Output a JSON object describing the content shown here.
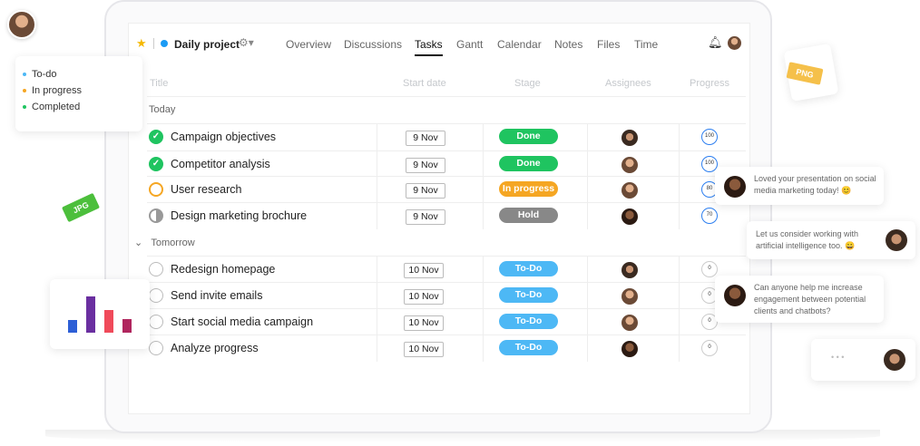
{
  "header": {
    "project": "Daily project",
    "tabs": [
      "Overview",
      "Discussions",
      "Tasks",
      "Gantt",
      "Calendar",
      "Notes",
      "Files",
      "Time"
    ],
    "active_tab": "Tasks"
  },
  "columns": [
    "Title",
    "Start date",
    "Stage",
    "Assignees",
    "Progress"
  ],
  "groups": [
    {
      "label": "Today",
      "tasks": [
        {
          "title": "Campaign objectives",
          "date": "9 Nov",
          "stage": "Done",
          "progress": "100",
          "status": "done"
        },
        {
          "title": "Competitor analysis",
          "date": "9 Nov",
          "stage": "Done",
          "progress": "100",
          "status": "done"
        },
        {
          "title": "User research",
          "date": "9 Nov",
          "stage": "In progress",
          "progress": "80",
          "status": "prog"
        },
        {
          "title": "Design marketing brochure",
          "date": "9 Nov",
          "stage": "Hold",
          "progress": "70",
          "status": "hold"
        }
      ]
    },
    {
      "label": "Tomorrow",
      "tasks": [
        {
          "title": "Redesign homepage",
          "date": "10 Nov",
          "stage": "To-Do",
          "progress": "0",
          "status": "todo"
        },
        {
          "title": "Send invite emails",
          "date": "10 Nov",
          "stage": "To-Do",
          "progress": "0",
          "status": "todo"
        },
        {
          "title": "Start social media campaign",
          "date": "10 Nov",
          "stage": "To-Do",
          "progress": "0",
          "status": "todo"
        },
        {
          "title": "Analyze progress",
          "date": "10 Nov",
          "stage": "To-Do",
          "progress": "0",
          "status": "todo"
        }
      ]
    }
  ],
  "stage_colors": {
    "Done": "#1fc460",
    "In progress": "#f5a623",
    "Hold": "#888888",
    "To-Do": "#4db8f5"
  },
  "legend": [
    {
      "label": "To-do",
      "color": "#4db8f5"
    },
    {
      "label": "In progress",
      "color": "#f5a623"
    },
    {
      "label": "Completed",
      "color": "#1fc460"
    }
  ],
  "chats": [
    "Loved your presentation on social media marketing today! 😊",
    "Let us consider working with artificial intelligence too. 😀",
    "Can anyone help me increase engagement between potential clients and chatbots?",
    "• • •"
  ],
  "file_tags": {
    "jpg": "JPG",
    "png": "PNG"
  },
  "bars": [
    {
      "color": "#2d5fd6",
      "value": 14
    },
    {
      "color": "#6a2fa0",
      "value": 40
    },
    {
      "color": "#f04a5a",
      "value": 25
    },
    {
      "color": "#b0265e",
      "value": 15
    }
  ]
}
